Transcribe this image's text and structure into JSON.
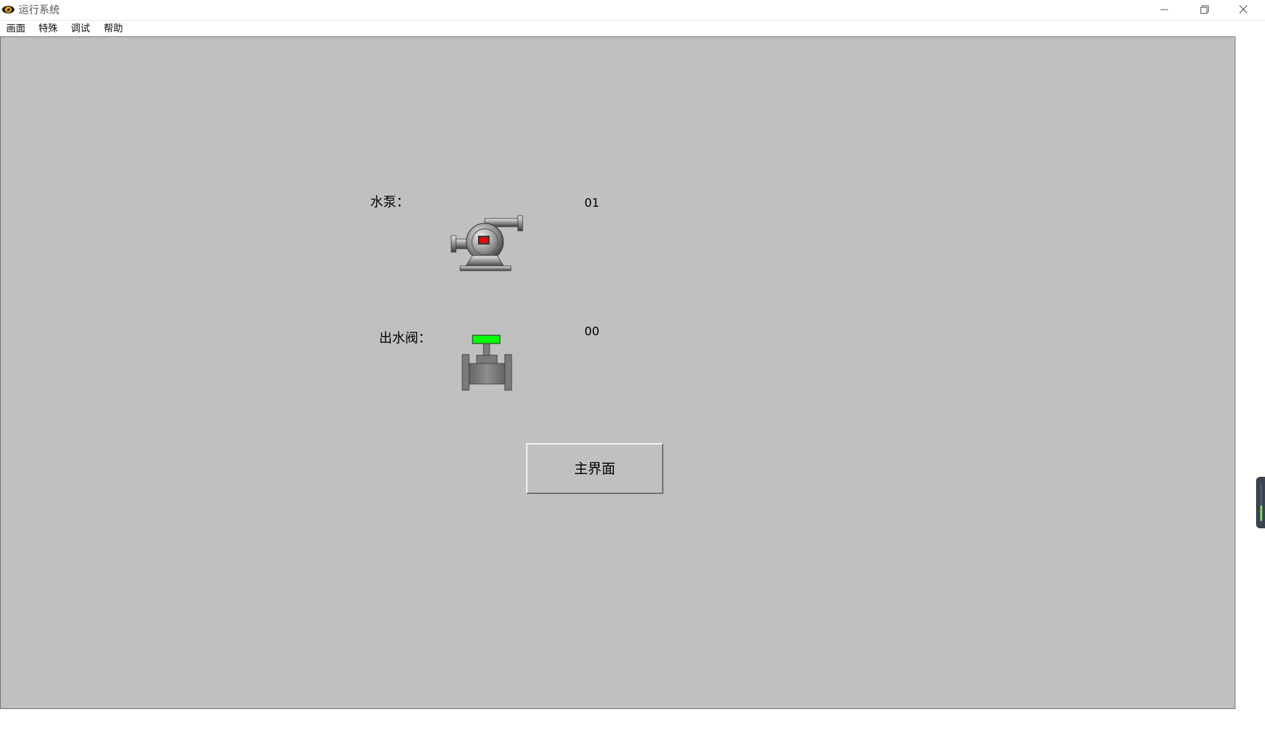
{
  "window": {
    "title": "运行系统",
    "icon": "eye-app-icon",
    "controls": [
      "minimize-icon",
      "restore-icon",
      "close-icon"
    ]
  },
  "menu": {
    "items": [
      {
        "label": "画面"
      },
      {
        "label": "特殊"
      },
      {
        "label": "调试"
      },
      {
        "label": "帮助"
      }
    ]
  },
  "canvas": {
    "background": "#c0c0c0",
    "pump": {
      "label": "水泵：",
      "value": "01",
      "indicator_color": "#ff0000",
      "icon": "water-pump-icon"
    },
    "valve": {
      "label": "出水阀：",
      "value": "00",
      "handle_color": "#00ff00",
      "icon": "valve-icon"
    },
    "main_button": {
      "label": "主界面"
    }
  }
}
